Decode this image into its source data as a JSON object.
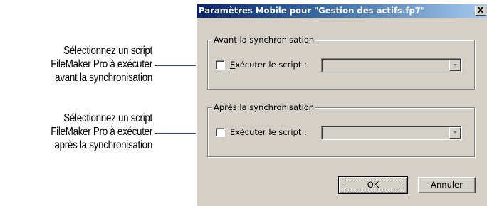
{
  "callouts": [
    {
      "lines": [
        "Sélectionnez un script",
        "FileMaker Pro à exécuter",
        "avant la synchronisation"
      ]
    },
    {
      "lines": [
        "Sélectionnez un script",
        "FileMaker Pro à exécuter",
        "après la synchronisation"
      ]
    }
  ],
  "dialog": {
    "title": "Paramètres Mobile pour \"Gestion des actifs.fp7\"",
    "close_glyph": "X",
    "groups": [
      {
        "legend": "Avant la synchronisation",
        "checkbox_label_prefix": "",
        "checkbox_label_mnemonic": "E",
        "checkbox_label_suffix": "xécuter le script :",
        "checked": false,
        "select_value": "",
        "enabled": false
      },
      {
        "legend": "Après la synchronisation",
        "checkbox_label_prefix": "Exécuter le ",
        "checkbox_label_mnemonic": "s",
        "checkbox_label_suffix": "cript :",
        "checked": false,
        "select_value": "",
        "enabled": false
      }
    ],
    "buttons": {
      "ok": "OK",
      "cancel": "Annuler"
    }
  },
  "colors": {
    "leader_line": "#1f3fa8",
    "dialog_face": "#d4d0c8",
    "titlebar_start": "#0a246a",
    "titlebar_end": "#a6caf0"
  }
}
